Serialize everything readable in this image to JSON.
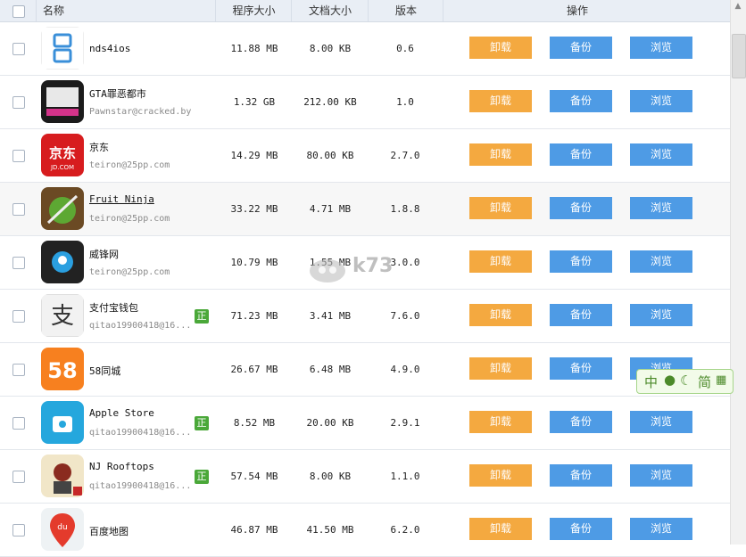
{
  "header": {
    "name": "名称",
    "size": "程序大小",
    "doc": "文档大小",
    "version": "版本",
    "action": "操作"
  },
  "buttons": {
    "uninstall": "卸载",
    "backup": "备份",
    "browse": "浏览"
  },
  "badge_label": "正",
  "apps": [
    {
      "name": "nds4ios",
      "publisher": "",
      "size": "11.88 MB",
      "doc": "8.00 KB",
      "version": "0.6",
      "badge": false,
      "icon": "nds4ios-icon"
    },
    {
      "name": "GTA罪恶都市",
      "publisher": "Pawnstar@cracked.by",
      "size": "1.32 GB",
      "doc": "212.00 KB",
      "version": "1.0",
      "badge": false,
      "icon": "gta-icon"
    },
    {
      "name": "京东",
      "publisher": "teiron@25pp.com",
      "size": "14.29 MB",
      "doc": "80.00 KB",
      "version": "2.7.0",
      "badge": false,
      "icon": "jd-icon"
    },
    {
      "name": "Fruit Ninja",
      "publisher": "teiron@25pp.com",
      "size": "33.22 MB",
      "doc": "4.71 MB",
      "version": "1.8.8",
      "badge": false,
      "icon": "fruit-ninja-icon"
    },
    {
      "name": "威锋网",
      "publisher": "teiron@25pp.com",
      "size": "10.79 MB",
      "doc": "1.55 MB",
      "version": "3.0.0",
      "badge": false,
      "icon": "weiphone-icon"
    },
    {
      "name": "支付宝钱包",
      "publisher": "qitao19900418@16...",
      "size": "71.23 MB",
      "doc": "3.41 MB",
      "version": "7.6.0",
      "badge": true,
      "icon": "alipay-icon"
    },
    {
      "name": "58同城",
      "publisher": "",
      "size": "26.67 MB",
      "doc": "6.48 MB",
      "version": "4.9.0",
      "badge": false,
      "icon": "58-icon"
    },
    {
      "name": "Apple Store",
      "publisher": "qitao19900418@16...",
      "size": "8.52 MB",
      "doc": "20.00 KB",
      "version": "2.9.1",
      "badge": true,
      "icon": "apple-store-icon"
    },
    {
      "name": "NJ Rooftops",
      "publisher": "qitao19900418@16...",
      "size": "57.54 MB",
      "doc": "8.00 KB",
      "version": "1.1.0",
      "badge": true,
      "icon": "nj-rooftops-icon"
    },
    {
      "name": "百度地图",
      "publisher": "",
      "size": "46.87 MB",
      "doc": "41.50 MB",
      "version": "6.2.0",
      "badge": false,
      "icon": "baidu-map-icon"
    }
  ],
  "watermark": "k73",
  "ime": {
    "mode": "中",
    "width": "简"
  },
  "colors": {
    "uninstall": "#f4a940",
    "button": "#4e9be5",
    "header": "#e9eef5",
    "badge": "#4aa839"
  }
}
